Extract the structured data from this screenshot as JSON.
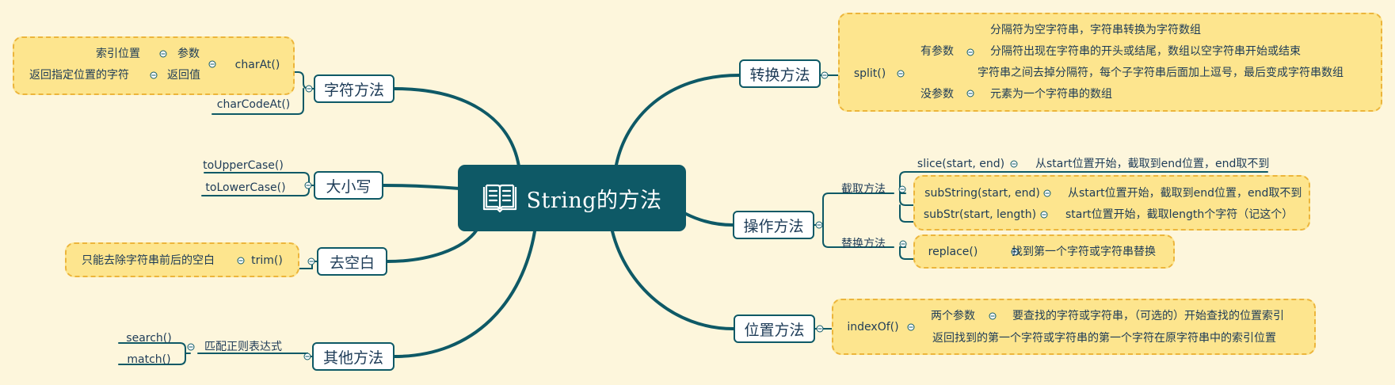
{
  "central": {
    "title": "String的方法",
    "icon": "book-icon"
  },
  "branches": {
    "char": {
      "label": "字符方法",
      "charAt": "charAt()",
      "param_value": "索引位置",
      "param_label": "参数",
      "return_value": "返回指定位置的字符",
      "return_label": "返回值",
      "charCodeAt": "charCodeAt()"
    },
    "case": {
      "label": "大小写",
      "upper": "toUpperCase()",
      "lower": "toLowerCase()"
    },
    "trim": {
      "label": "去空白",
      "method": "trim()",
      "desc": "只能去除字符串前后的空白"
    },
    "other": {
      "label": "其他方法",
      "group": "匹配正则表达式",
      "search": "search()",
      "match": "match()"
    },
    "convert": {
      "label": "转换方法",
      "split": "split()",
      "with_param": "有参数",
      "no_param": "没参数",
      "w1": "分隔符为空字符串，字符串转换为字符数组",
      "w2": "分隔符出现在字符串的开头或结尾，数组以空字符串开始或结束",
      "w3": "字符串之间去掉分隔符，每个子字符串后面加上逗号，最后变成字符串数组",
      "n1": "元素为一个字符串的数组"
    },
    "operate": {
      "label": "操作方法",
      "cut": "截取方法",
      "replace_group": "替换方法",
      "slice": "slice(start, end)",
      "slice_desc": "从start位置开始，截取到end位置，end取不到",
      "substring": "subString(start, end)",
      "substring_desc": "从start位置开始，截取到end位置，end取不到",
      "substr": "subStr(start, length)",
      "substr_desc": "start位置开始，截取length个字符（记这个）",
      "replace": "replace()",
      "replace_desc": "找到第一个字符或字符串替换"
    },
    "position": {
      "label": "位置方法",
      "indexOf": "indexOf()",
      "two_params": "两个参数",
      "two_params_desc": "要查找的字符或字符串，（可选的）开始查找的位置索引",
      "return_desc": "返回找到的第一个字符或字符串的第一个字符在原字符串中的索引位置"
    }
  },
  "colors": {
    "background": "#fdf6dc",
    "node_dark": "#0e5966",
    "boundary_fill": "#fde58e",
    "boundary_border": "#ecb53b",
    "text": "#1d3b57"
  }
}
